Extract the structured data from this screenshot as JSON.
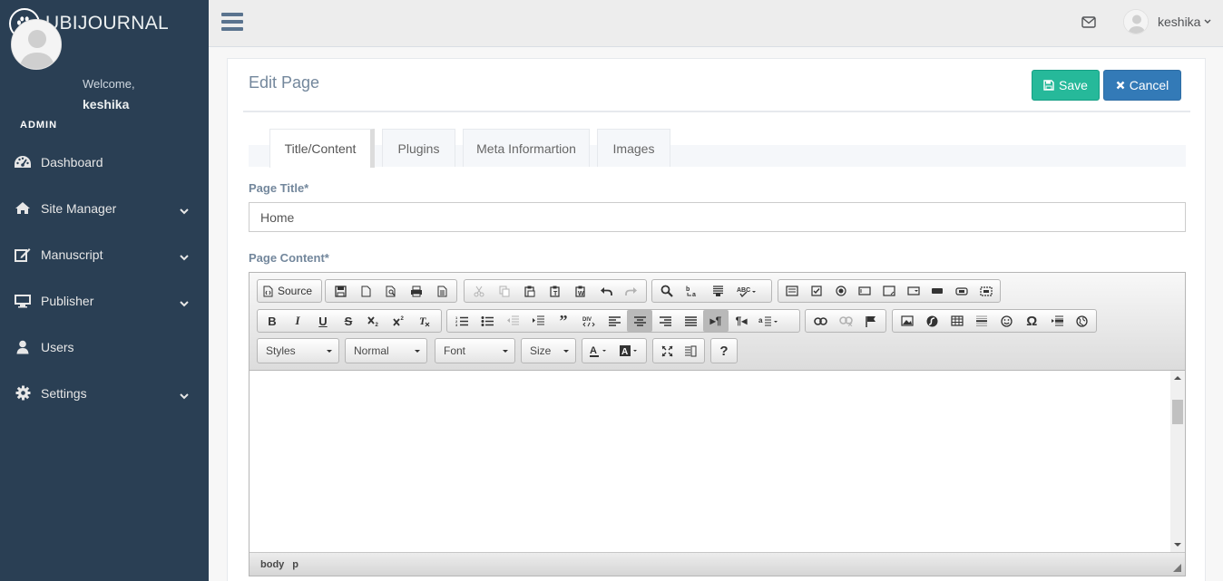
{
  "brand": {
    "name": "UBIJOURNAL",
    "icon": "paw-icon"
  },
  "profile": {
    "welcome": "Welcome,",
    "username": "keshika",
    "role": "ADMIN"
  },
  "sidebar": {
    "items": [
      {
        "label": "Dashboard",
        "icon": "dashboard-icon",
        "has_children": false
      },
      {
        "label": "Site Manager",
        "icon": "home-icon",
        "has_children": true
      },
      {
        "label": "Manuscript",
        "icon": "edit-icon",
        "has_children": true
      },
      {
        "label": "Publisher",
        "icon": "monitor-icon",
        "has_children": true
      },
      {
        "label": "Users",
        "icon": "user-icon",
        "has_children": false
      },
      {
        "label": "Settings",
        "icon": "gear-icon",
        "has_children": true
      }
    ]
  },
  "topbar": {
    "username": "keshika"
  },
  "page": {
    "title": "Edit Page",
    "save_label": "Save",
    "cancel_label": "Cancel",
    "tabs": [
      "Title/Content",
      "Plugins",
      "Meta Informartion",
      "Images"
    ],
    "active_tab": "Title/Content",
    "page_title_label": "Page Title*",
    "page_title_value": "Home",
    "page_content_label": "Page Content*"
  },
  "editor": {
    "source_label": "Source",
    "combos": [
      "Styles",
      "Normal",
      "Font",
      "Size"
    ],
    "path": [
      "body",
      "p"
    ]
  },
  "colors": {
    "sidebar": "#2a3f54",
    "save": "#26b99a",
    "cancel": "#337ab7",
    "title": "#73879c"
  }
}
